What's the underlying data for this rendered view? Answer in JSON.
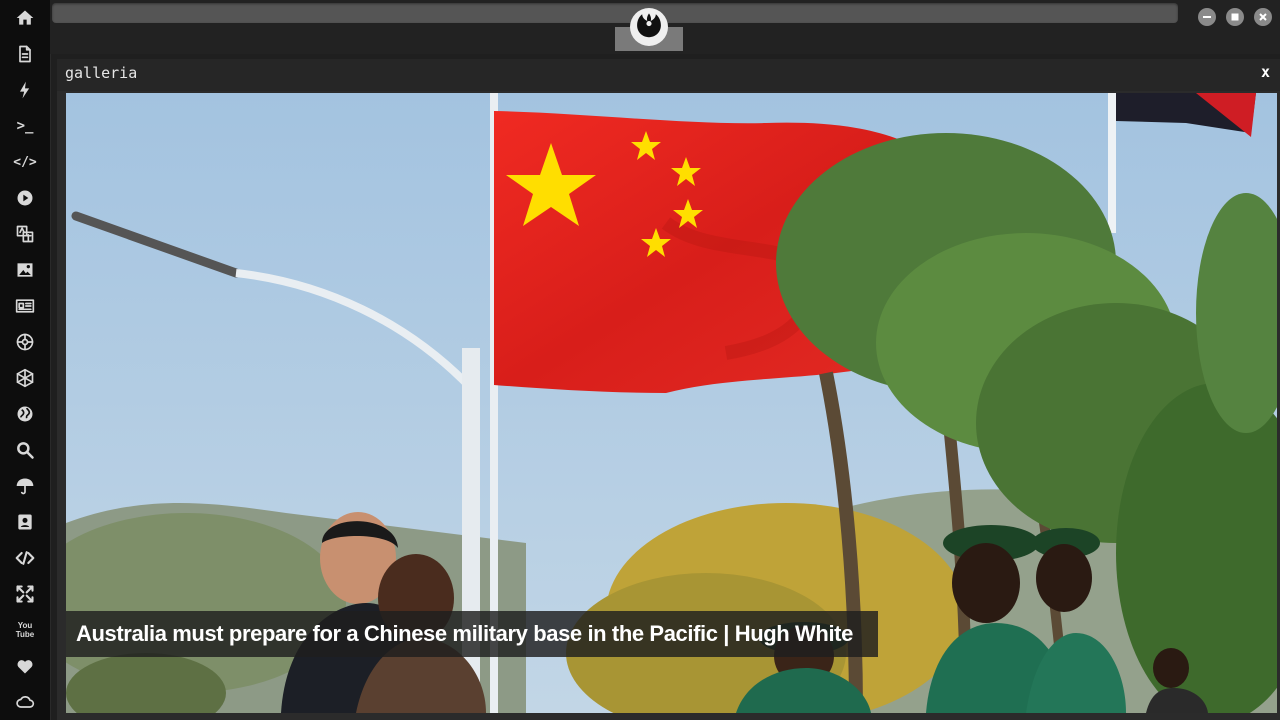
{
  "sidebar": {
    "items": [
      {
        "name": "home"
      },
      {
        "name": "document"
      },
      {
        "name": "lightning"
      },
      {
        "name": "terminal",
        "text": ">_"
      },
      {
        "name": "code",
        "text": "</>"
      },
      {
        "name": "play"
      },
      {
        "name": "translate"
      },
      {
        "name": "image"
      },
      {
        "name": "newspaper"
      },
      {
        "name": "rebel"
      },
      {
        "name": "empire"
      },
      {
        "name": "globe"
      },
      {
        "name": "search"
      },
      {
        "name": "umbrella"
      },
      {
        "name": "contact"
      },
      {
        "name": "code-alt"
      },
      {
        "name": "expand"
      },
      {
        "name": "youtube",
        "text": "You\nTube"
      },
      {
        "name": "heart"
      },
      {
        "name": "cloud"
      }
    ]
  },
  "window": {
    "title": "galleria",
    "close_label": "x"
  },
  "gallery": {
    "caption": "Australia must prepare for a Chinese military base in the Pacific | Hugh White"
  },
  "colors": {
    "sidebar_bg": "#0d0d0d",
    "topbar_bg": "#222222",
    "caption_bg": "rgba(30,30,30,0.82)",
    "flag_red": "#e8231f",
    "flag_star": "#ffde00"
  }
}
